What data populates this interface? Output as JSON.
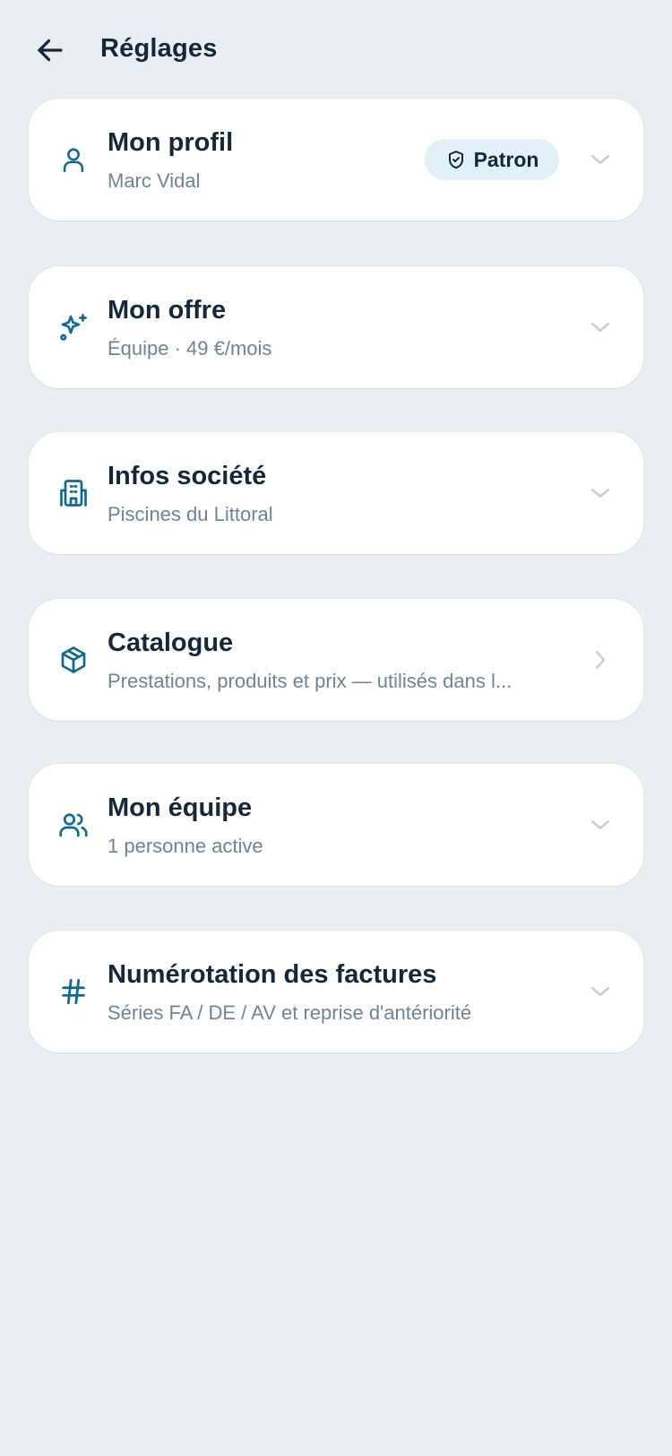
{
  "header": {
    "title": "Réglages",
    "back_icon": "arrow-left-icon"
  },
  "colors": {
    "background": "#e9eef3",
    "card": "#ffffff",
    "accent": "#0f6a94",
    "title_text": "#13283a",
    "subtitle_text": "#6e8494",
    "chevron": "#c4ced8",
    "badge_bg": "#e2f0f7"
  },
  "sections": [
    {
      "title": "Mon profil",
      "subtitle": "Marc Vidal",
      "icon": "user-icon",
      "badge": {
        "label": "Patron",
        "icon": "shield-check-icon"
      },
      "chevron": "chevron-down-icon"
    },
    {
      "title": "Mon offre",
      "subtitle": "Équipe · 49 €/mois",
      "icon": "sparkles-icon",
      "chevron": "chevron-down-icon"
    },
    {
      "title": "Infos société",
      "subtitle": "Piscines du Littoral",
      "icon": "building-icon",
      "chevron": "chevron-down-icon"
    },
    {
      "title": "Catalogue",
      "subtitle": "Prestations, produits et prix — utilisés dans l...",
      "icon": "package-icon",
      "chevron": "chevron-right-icon"
    },
    {
      "title": "Mon équipe",
      "subtitle": "1 personne active",
      "icon": "users-icon",
      "chevron": "chevron-down-icon"
    },
    {
      "title": "Numérotation des factures",
      "subtitle": "Séries FA / DE / AV et reprise d'antériorité",
      "icon": "hash-icon",
      "chevron": "chevron-down-icon"
    }
  ]
}
